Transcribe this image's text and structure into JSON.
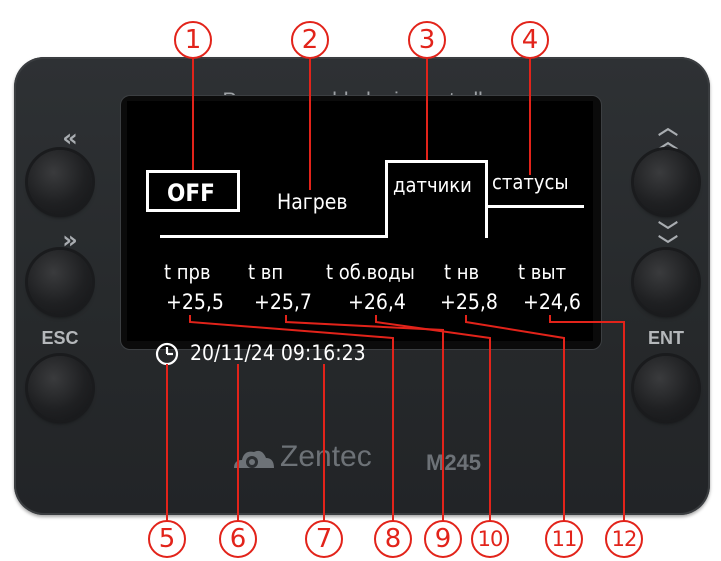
{
  "device": {
    "title": "Programmable logic controller",
    "brand": "Zentec",
    "model": "M245",
    "buttons": {
      "left_top": "«",
      "left_mid": "»",
      "esc": "ESC",
      "right_top": "⌃⌃",
      "right_mid": "⌄⌄",
      "ent": "ENT"
    }
  },
  "screen": {
    "status_box": "OFF",
    "mode": "Нагрев",
    "tabs": [
      "датчики",
      "статусы"
    ],
    "sensors": [
      {
        "label": "t прв",
        "value": "+25,5"
      },
      {
        "label": "t вп",
        "value": "+25,7"
      },
      {
        "label": "t об.воды",
        "value": "+26,4"
      },
      {
        "label": "t нв",
        "value": "+25,8"
      },
      {
        "label": "t выт",
        "value": "+24,6"
      }
    ],
    "datetime": "20/11/24 09:16:23"
  },
  "callouts": [
    "1",
    "2",
    "3",
    "4",
    "5",
    "6",
    "7",
    "8",
    "9",
    "10",
    "11",
    "12"
  ],
  "colors": {
    "callout": "#e2231a",
    "device": "#2a2d30",
    "screen": "#000000",
    "text": "#ffffff"
  }
}
